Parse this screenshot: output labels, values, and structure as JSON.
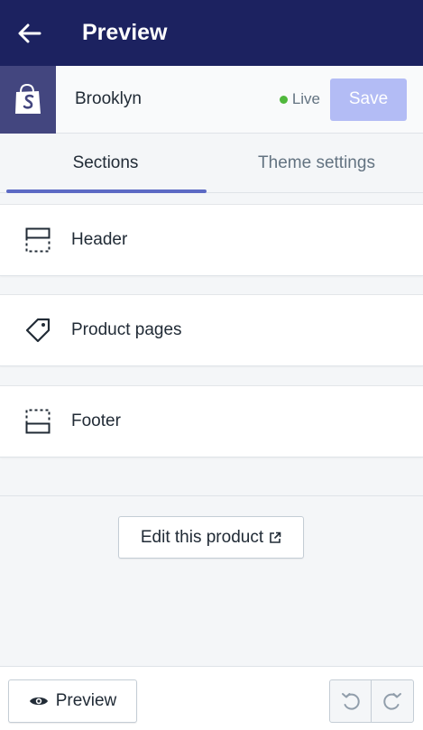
{
  "topbar": {
    "back_icon": "arrow-left-icon",
    "title": "Preview",
    "background": "#1c2260"
  },
  "theme": {
    "logo_icon": "shopify-bag-icon",
    "name": "Brooklyn",
    "status": "Live",
    "status_color": "#50b83c",
    "save_label": "Save"
  },
  "tabs": [
    {
      "label": "Sections",
      "active": true
    },
    {
      "label": "Theme settings",
      "active": false
    }
  ],
  "sections": [
    {
      "label": "Header",
      "icon": "header-layout-icon"
    },
    {
      "label": "Product pages",
      "icon": "tag-icon"
    },
    {
      "label": "Footer",
      "icon": "footer-layout-icon"
    }
  ],
  "edit_button": {
    "label": "Edit this product",
    "icon": "external-link-icon"
  },
  "footer_bar": {
    "preview_label": "Preview",
    "preview_icon": "eye-icon",
    "undo_icon": "undo-icon",
    "redo_icon": "redo-icon"
  },
  "colors": {
    "accent": "#5c6ac4",
    "save_disabled": "#b3bcf5"
  }
}
